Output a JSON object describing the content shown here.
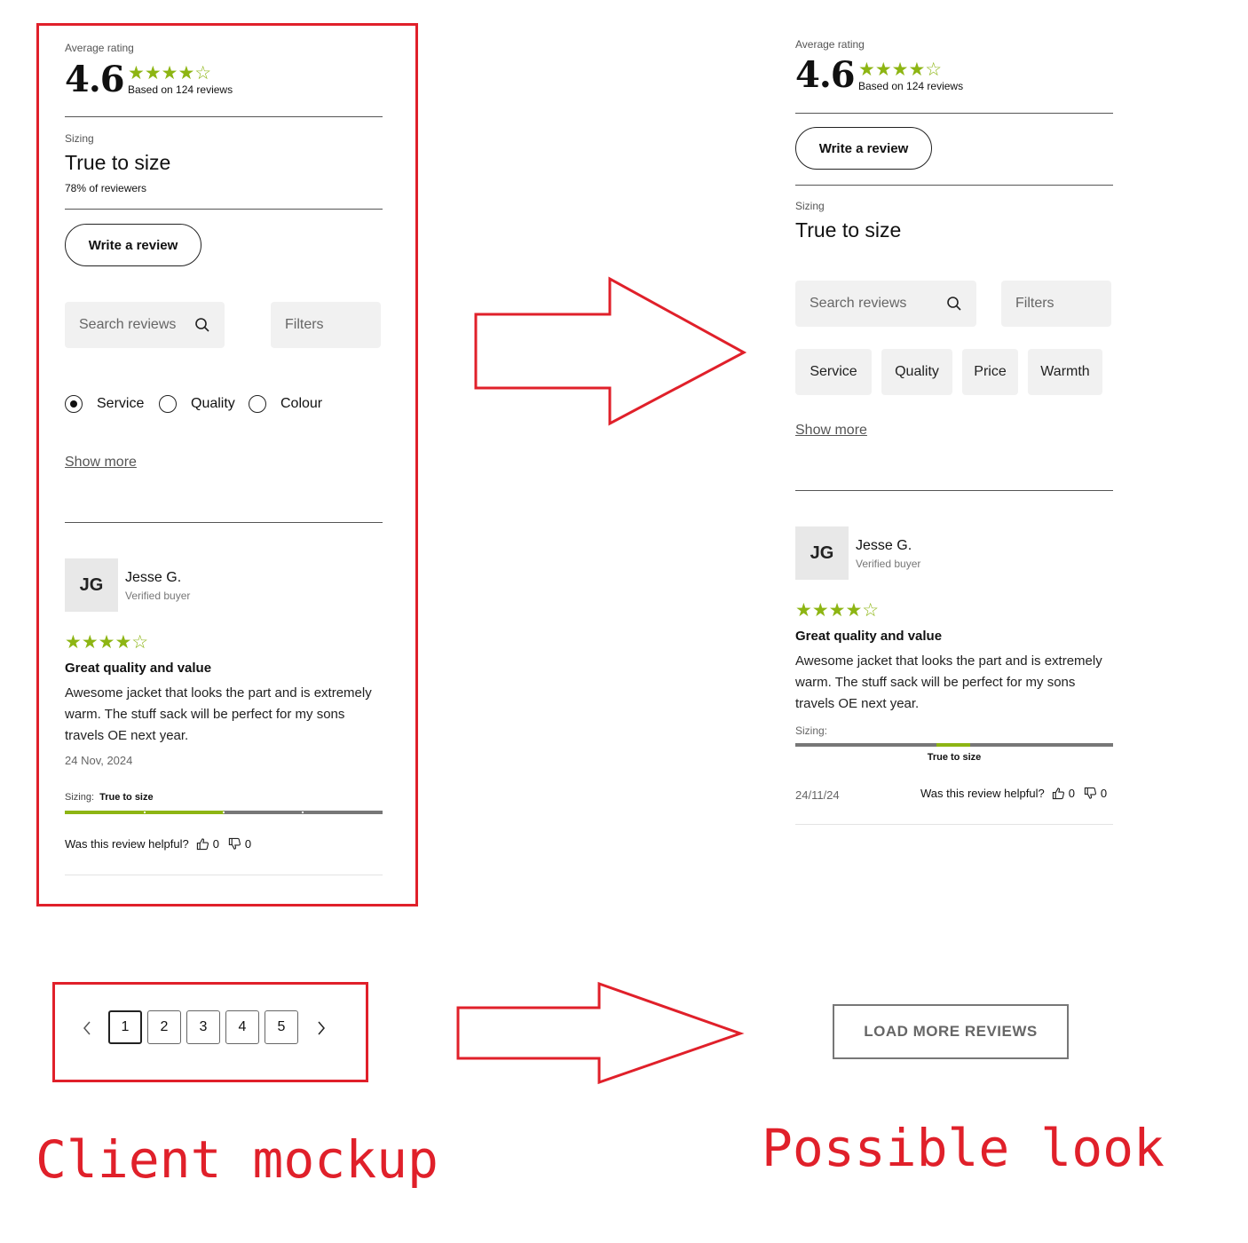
{
  "mockup": {
    "avg_label": "Average rating",
    "avg_value": "4.6",
    "stars": "★★★★☆",
    "based_on": "Based on 124 reviews",
    "sizing_label": "Sizing",
    "sizing_value": "True to size",
    "sizing_pct": "78% of reviewers",
    "write_review": "Write a review",
    "search_placeholder": "Search reviews",
    "filters": "Filters",
    "radio_options": [
      "Service",
      "Quality",
      "Colour"
    ],
    "show_more": "Show more",
    "review": {
      "initials": "JG",
      "name": "Jesse G.",
      "verified": "Verified buyer",
      "stars": "★★★★☆",
      "title": "Great quality and value",
      "body": "Awesome jacket that looks the part and is extremely warm. The stuff sack will be perfect for my sons travels OE next year.",
      "date": "24 Nov, 2024",
      "sizing_label": "Sizing:",
      "sizing_value": "True to size",
      "sizing_fill": 0.5,
      "helpful_q": "Was this review helpful?",
      "up_count": "0",
      "down_count": "0"
    },
    "pagination": [
      "1",
      "2",
      "3",
      "4",
      "5"
    ],
    "active_page": "1"
  },
  "possible": {
    "avg_label": "Average rating",
    "avg_value": "4.6",
    "stars": "★★★★☆",
    "based_on": "Based on 124 reviews",
    "write_review": "Write a review",
    "sizing_label": "Sizing",
    "sizing_value": "True to size",
    "search_placeholder": "Search reviews",
    "filters": "Filters",
    "chips": [
      "Service",
      "Quality",
      "Price",
      "Warmth"
    ],
    "show_more": "Show more",
    "review": {
      "initials": "JG",
      "name": "Jesse G.",
      "verified": "Verified buyer",
      "stars": "★★★★☆",
      "title": "Great quality and value",
      "body": "Awesome jacket that looks the part and is extremely warm. The stuff sack will be perfect for my sons travels OE next year.",
      "sizing_label": "Sizing:",
      "sizing_value": "True to size",
      "date": "24/11/24",
      "helpful_q": "Was this review helpful?",
      "up_count": "0",
      "down_count": "0"
    },
    "load_more": "LOAD MORE REVIEWS"
  },
  "captions": {
    "left": "Client mockup",
    "right": "Possible look"
  },
  "colors": {
    "accent_green": "#8db513",
    "annotation_red": "#e0202a"
  }
}
